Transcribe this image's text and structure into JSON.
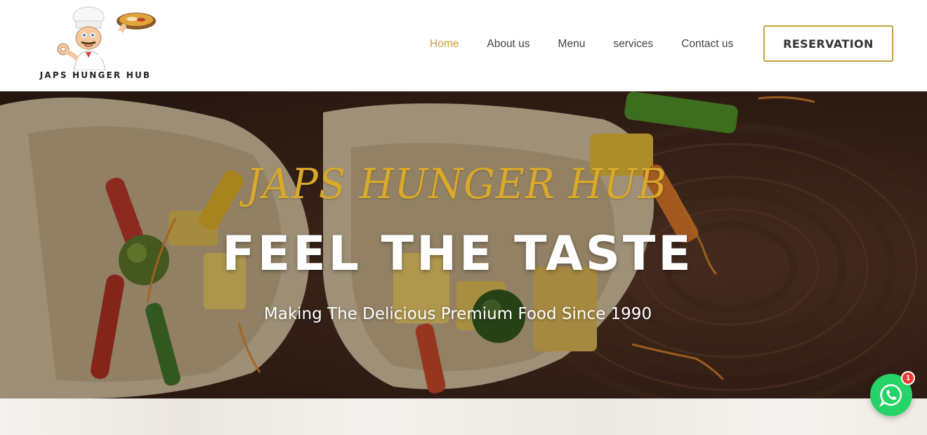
{
  "brand": {
    "name": "JAPS HUNGER HUB",
    "logo_icon": "chef-icon"
  },
  "nav": {
    "items": [
      {
        "label": "Home",
        "active": true
      },
      {
        "label": "About us",
        "active": false
      },
      {
        "label": "Menu",
        "active": false
      },
      {
        "label": "services",
        "active": false
      },
      {
        "label": "Contact us",
        "active": false
      }
    ],
    "reservation_label": "RESERVATION"
  },
  "hero": {
    "script_title": "JAPS HUNGER HUB",
    "title": "FEEL THE TASTE",
    "subtitle": "Making The Delicious Premium Food Since 1990",
    "background_icon": "food-wraps-photo"
  },
  "whatsapp": {
    "icon": "whatsapp-icon",
    "badge_count": "1"
  },
  "colors": {
    "accent": "#c9a13a",
    "script_gold": "#d8a92a",
    "whatsapp_green": "#25d366",
    "badge_red": "#e53935"
  }
}
